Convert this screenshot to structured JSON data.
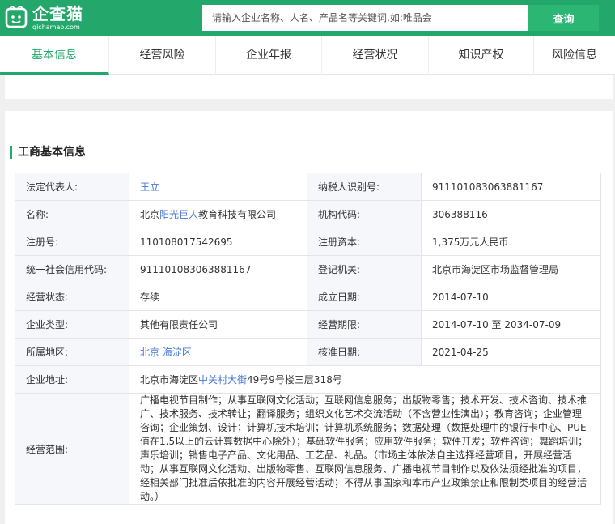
{
  "brand": {
    "name": "企查猫",
    "domain": "qichamao.com",
    "color": "#23a76a"
  },
  "search": {
    "placeholder": "请输入企业名称、人名、产品名等关键词,如:唯品会",
    "button_label": "查询"
  },
  "nav": {
    "active": 0,
    "tabs": [
      "基本信息",
      "经营风险",
      "企业年报",
      "经营状况",
      "知识产权",
      "风险信息"
    ]
  },
  "section": {
    "title": "工商基本信息"
  },
  "info": {
    "legal_rep": {
      "label": "法定代表人:",
      "value": "王立"
    },
    "taxpayer_id": {
      "label": "纳税人识别号:",
      "value": "911101083063881167"
    },
    "name": {
      "label": "名称:",
      "prefix": "北京",
      "highlight": "阳光巨人",
      "suffix": "教育科技有限公司"
    },
    "org_code": {
      "label": "机构代码:",
      "value": "306388116"
    },
    "reg_no": {
      "label": "注册号:",
      "value": "110108017542695"
    },
    "reg_capital": {
      "label": "注册资本:",
      "value": "1,375万元人民币"
    },
    "credit_code": {
      "label": "统一社会信用代码:",
      "value": "911101083063881167"
    },
    "reg_authority": {
      "label": "登记机关:",
      "value": "北京市海淀区市场监督管理局"
    },
    "status": {
      "label": "经营状态:",
      "value": "存续"
    },
    "established": {
      "label": "成立日期:",
      "value": "2014-07-10"
    },
    "company_type": {
      "label": "企业类型:",
      "value": "其他有限责任公司"
    },
    "term": {
      "label": "经营期限:",
      "value": "2014-07-10 至 2034-07-09"
    },
    "region": {
      "label": "所属地区:",
      "city": "北京",
      "district": "海淀区"
    },
    "approval_date": {
      "label": "核准日期:",
      "value": "2021-04-25"
    },
    "address": {
      "label": "企业地址:",
      "prefix": "北京市海淀区",
      "highlight": "中关村大街",
      "suffix": "49号9号楼三层318号"
    },
    "scope": {
      "label": "经营范围:",
      "value": "广播电视节目制作；从事互联网文化活动；互联网信息服务；出版物零售；技术开发、技术咨询、技术推广、技术服务、技术转让；翻译服务；组织文化艺术交流活动（不含营业性演出）；教育咨询；企业管理咨询；企业策划、设计；计算机技术培训；计算机系统服务；数据处理（数据处理中的银行卡中心、PUE值在1.5以上的云计算数据中心除外）；基础软件服务；应用软件服务；软件开发；软件咨询；舞蹈培训；声乐培训；销售电子产品、文化用品、工艺品、礼品。（市场主体依法自主选择经营项目，开展经营活动；从事互联网文化活动、出版物零售、互联网信息服务、广播电视节目制作以及依法须经批准的项目，经相关部门批准后依批准的内容开展经营活动；不得从事国家和本市产业政策禁止和限制类项目的经营活动。）"
    }
  }
}
